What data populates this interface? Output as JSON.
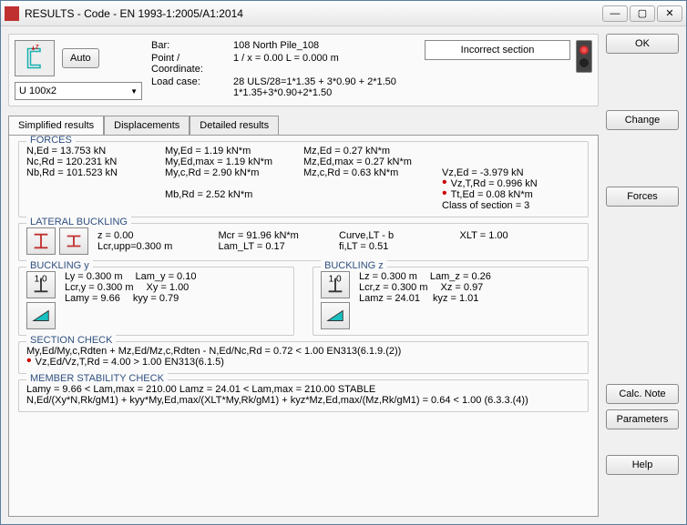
{
  "window": {
    "title": "RESULTS - Code - EN 1993-1:2005/A1:2014"
  },
  "top": {
    "auto_label": "Auto",
    "profile_select": "U 100x2",
    "bar_label": "Bar:",
    "bar_value": "108  North Pile_108",
    "point_label": "Point / Coordinate:",
    "point_value": "1 / x = 0.00 L = 0.000 m",
    "load_label": "Load case:",
    "load_value": "28 ULS/28=1*1.35 + 3*0.90 + 2*1.50  1*1.35+3*0.90+2*1.50",
    "status": "Incorrect section"
  },
  "tabs": {
    "t1": "Simplified results",
    "t2": "Displacements",
    "t3": "Detailed results"
  },
  "forces": {
    "title": "FORCES",
    "n_ed": "N,Ed = 13.753 kN",
    "my_ed": "My,Ed = 1.19 kN*m",
    "mz_ed": "Mz,Ed = 0.27 kN*m",
    "nc_rd": "Nc,Rd = 120.231 kN",
    "my_edmax": "My,Ed,max = 1.19 kN*m",
    "mz_edmax": "Mz,Ed,max = 0.27 kN*m",
    "nb_rd": "Nb,Rd = 101.523 kN",
    "my_crd": "My,c,Rd = 2.90 kN*m",
    "mz_crd": "Mz,c,Rd = 0.63 kN*m",
    "vz_ed": "Vz,Ed = -3.979 kN",
    "vz_trd": "Vz,T,Rd = 0.996 kN",
    "mb_rd": "Mb,Rd = 2.52 kN*m",
    "tt_ed": "Tt,Ed = 0.08 kN*m",
    "class": "Class of section = 3"
  },
  "lat": {
    "title": "LATERAL BUCKLING",
    "z": "z = 0.00",
    "mcr": "Mcr = 91.96 kN*m",
    "curve": "Curve,LT - b",
    "xlt": "XLT = 1.00",
    "lcr": "Lcr,upp=0.300 m",
    "lam_lt": "Lam_LT = 0.17",
    "fi_lt": "fi,LT = 0.51"
  },
  "buckY": {
    "title": "BUCKLING y",
    "ly": "Ly = 0.300 m",
    "lam_y": "Lam_y = 0.10",
    "lcr_y": "Lcr,y = 0.300 m",
    "xy": "Xy = 1.00",
    "lamy": "Lamy = 9.66",
    "kyy": "kyy = 0.79"
  },
  "buckZ": {
    "title": "BUCKLING z",
    "lz": "Lz = 0.300 m",
    "lam_z": "Lam_z = 0.26",
    "lcr_z": "Lcr,z = 0.300 m",
    "xz": "Xz = 0.97",
    "lamz": "Lamz = 24.01",
    "kyz": "kyz = 1.01"
  },
  "section": {
    "title": "SECTION CHECK",
    "l1": "My,Ed/My,c,Rdten + Mz,Ed/Mz,c,Rdten - N,Ed/Nc,Rd = 0.72 < 1.00   EN313(6.1.9.(2))",
    "l2": "Vz,Ed/Vz,T,Rd = 4.00 > 1.00   EN313(6.1.5)"
  },
  "member": {
    "title": "MEMBER STABILITY CHECK",
    "l1": "Lamy = 9.66 < Lam,max = 210.00          Lamz = 24.01 < Lam,max = 210.00    STABLE",
    "l2": "N,Ed/(Xy*N,Rk/gM1) + kyy*My,Ed,max/(XLT*My,Rk/gM1) + kyz*Mz,Ed,max/(Mz,Rk/gM1) = 0.64 < 1.00   (6.3.3.(4))"
  },
  "buttons": {
    "ok": "OK",
    "change": "Change",
    "forces": "Forces",
    "calcnote": "Calc. Note",
    "parameters": "Parameters",
    "help": "Help"
  }
}
